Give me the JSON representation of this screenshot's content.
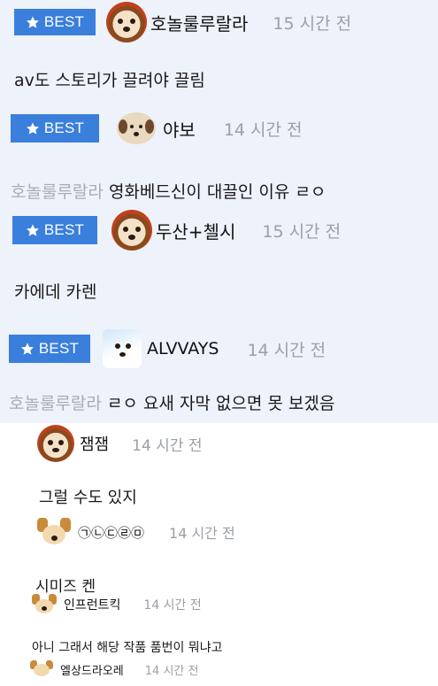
{
  "best_label": "BEST",
  "comments": [
    {
      "user": "호놀룰루랄라",
      "time": "15 시간 전",
      "text": "av도 스토리가 끌려야 끌림",
      "mention": ""
    },
    {
      "user": "야보",
      "time": "14 시간 전",
      "text": "영화베드신이 대끌인 이유 ㄹㅇ",
      "mention": "호놀룰루랄라"
    },
    {
      "user": "두산+첼시",
      "time": "15 시간 전",
      "text": "카에데 카렌",
      "mention": ""
    },
    {
      "user": "ALVVAYS",
      "time": "14 시간 전",
      "text": "ㄹㅇ 요새 자막 없으면 못 보겠음",
      "mention": "호놀룰루랄라"
    }
  ],
  "replies": [
    {
      "user": "잼잼",
      "time": "14 시간 전",
      "text": "그럴 수도 있지"
    },
    {
      "user": "㉠㉡㉢㉣㉤",
      "time": "14 시간 전",
      "text": "시미즈 켄"
    },
    {
      "user": "인프런트킥",
      "time": "14 시간 전",
      "text": "아니 그래서 해당 작품 품번이 뭐냐고"
    },
    {
      "user": "엘상드라오레",
      "time": "14 시간 전",
      "text": ""
    }
  ],
  "colors": {
    "badge": "#3a7fdc",
    "best_background": "#eef2fa",
    "muted": "#9aa0a8"
  },
  "icons": {
    "badge_icon": "star-icon"
  }
}
